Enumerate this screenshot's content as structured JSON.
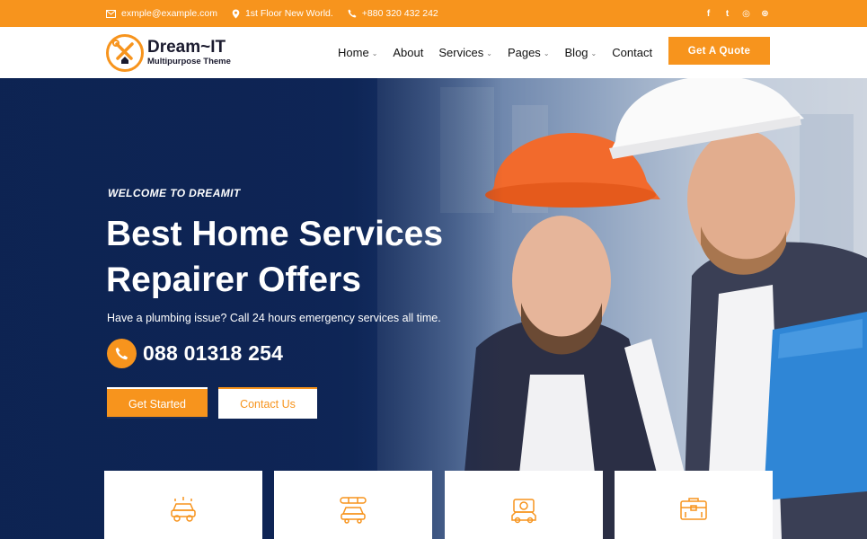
{
  "topbar": {
    "email": "exmple@example.com",
    "address": "1st Floor New World.",
    "phone": "+880 320 432 242",
    "social": [
      "facebook-icon",
      "twitter-icon",
      "instagram-icon",
      "dribbble-icon"
    ],
    "social_glyphs": [
      "f",
      "t",
      "◎",
      "⊛"
    ]
  },
  "header": {
    "logo_name": "Dream~IT",
    "logo_tagline": "Multipurpose Theme",
    "nav": [
      {
        "label": "Home",
        "has_dropdown": true
      },
      {
        "label": "About",
        "has_dropdown": false
      },
      {
        "label": "Services",
        "has_dropdown": true
      },
      {
        "label": "Pages",
        "has_dropdown": true
      },
      {
        "label": "Blog",
        "has_dropdown": true
      },
      {
        "label": "Contact",
        "has_dropdown": false
      }
    ],
    "quote_button": "Get A Quote"
  },
  "hero": {
    "welcome": "WELCOME TO DREAMIT",
    "title_line1": "Best Home Services",
    "title_line2": "Repairer Offers",
    "subtitle": "Have a plumbing issue? Call 24 hours emergency services all time.",
    "phone": "088 01318 254",
    "primary_button": "Get Started",
    "secondary_button": "Contact Us"
  },
  "cards": [
    {
      "icon": "car-wash-icon"
    },
    {
      "icon": "car-repair-icon"
    },
    {
      "icon": "engine-service-icon"
    },
    {
      "icon": "toolbox-icon"
    }
  ],
  "colors": {
    "accent": "#f7941d",
    "hero_dark": "#10295c",
    "text_dark": "#1a1a2e"
  }
}
